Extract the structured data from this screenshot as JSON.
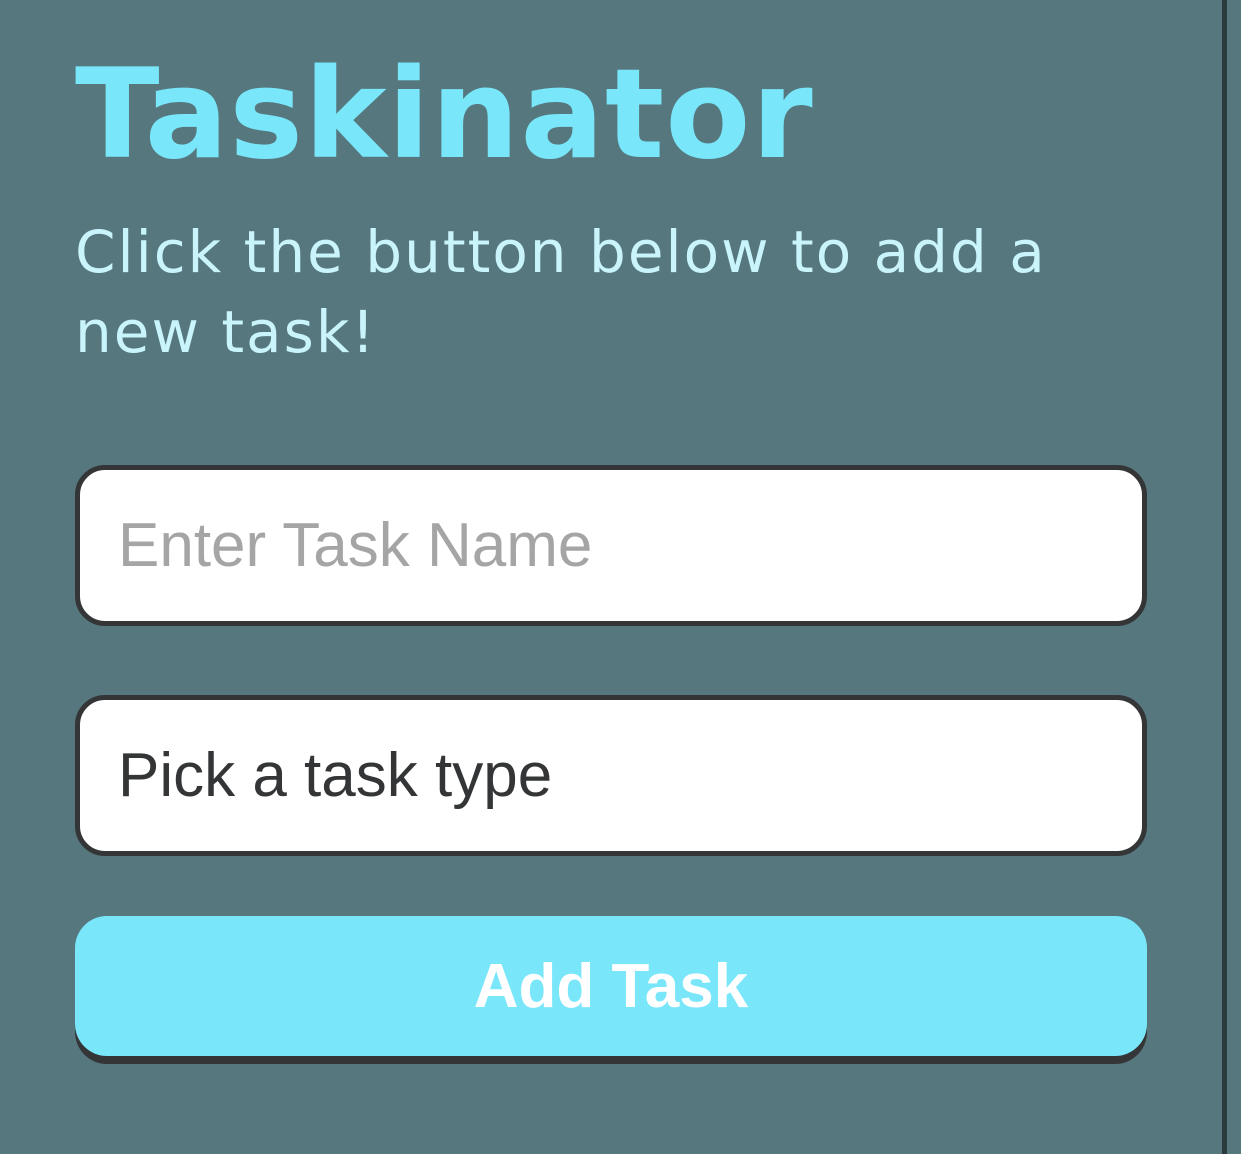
{
  "header": {
    "title": "Taskinator",
    "subtitle": "Click the button below to add a new task!"
  },
  "form": {
    "task_name_placeholder": "Enter Task Name",
    "task_type_selected": "Pick a task type",
    "submit_label": "Add Task"
  },
  "colors": {
    "background": "#55777d",
    "accent": "#79e6fa",
    "subtitle": "#c9f4fb",
    "border": "#333536"
  }
}
